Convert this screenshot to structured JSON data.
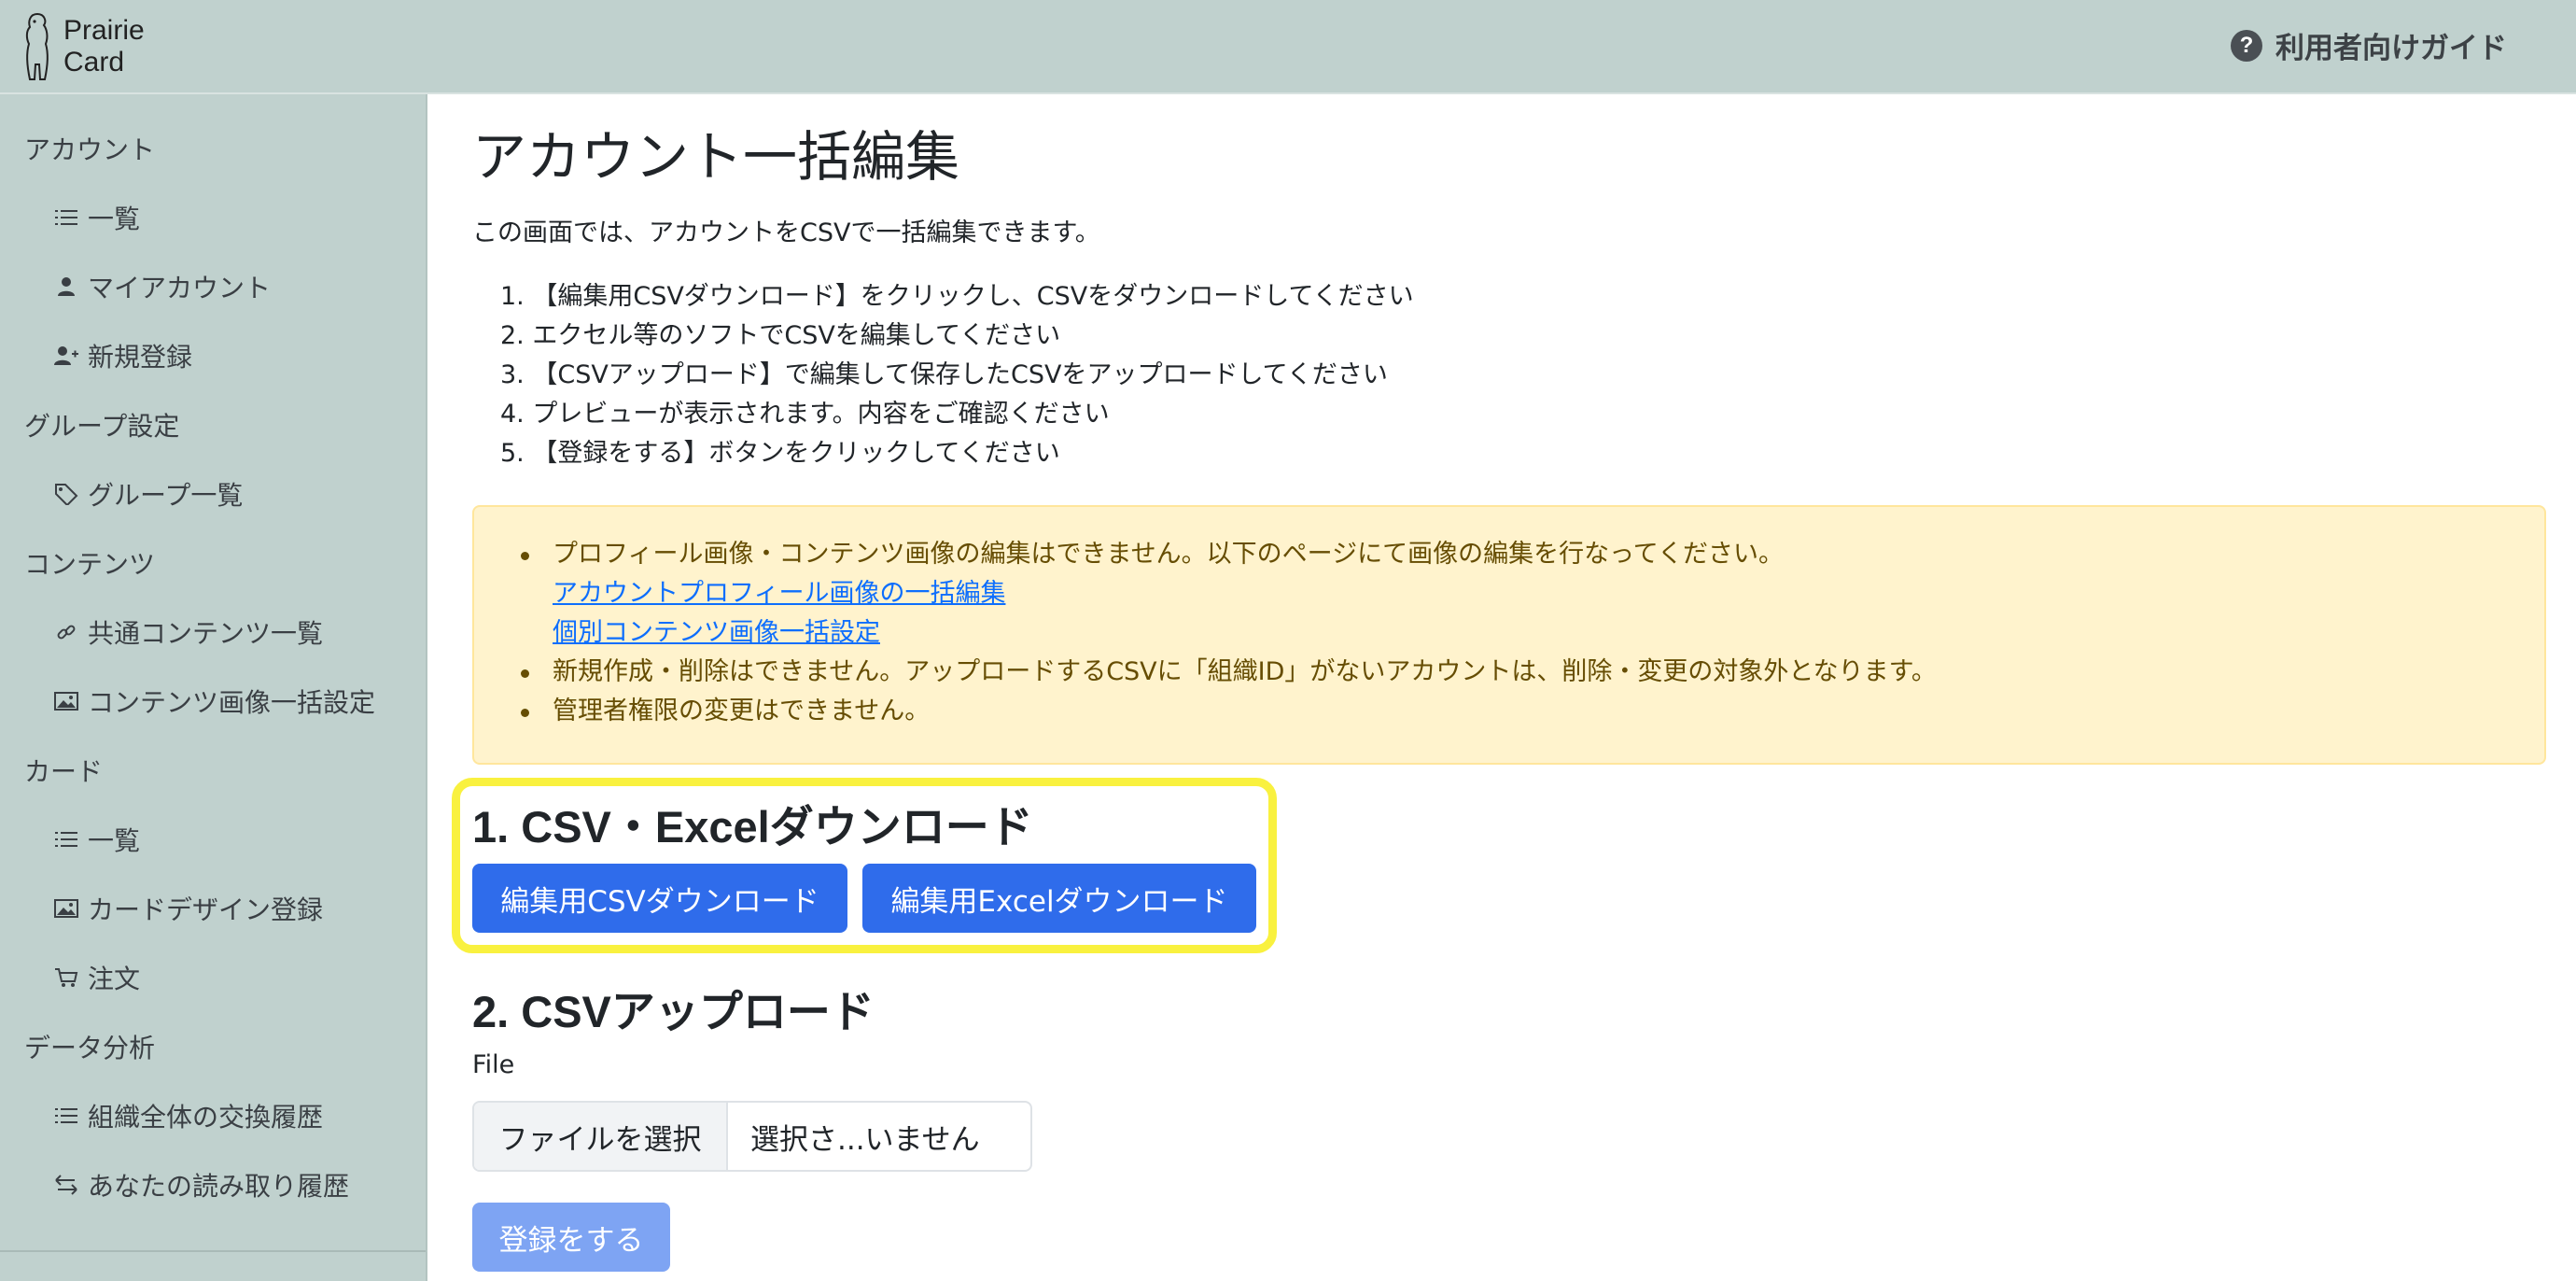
{
  "header": {
    "logo_line1": "Prairie",
    "logo_line2": "Card",
    "guide_label": "利用者向けガイド",
    "guide_icon": "question-circle-icon"
  },
  "sidebar": {
    "sections": [
      {
        "label": "アカウント",
        "items": [
          {
            "label": "一覧",
            "icon": "list-icon"
          },
          {
            "label": "マイアカウント",
            "icon": "person-icon"
          },
          {
            "label": "新規登録",
            "icon": "person-add-icon"
          }
        ]
      },
      {
        "label": "グループ設定",
        "items": [
          {
            "label": "グループ一覧",
            "icon": "tags-icon"
          }
        ]
      },
      {
        "label": "コンテンツ",
        "items": [
          {
            "label": "共通コンテンツ一覧",
            "icon": "link-icon"
          },
          {
            "label": "コンテンツ画像一括設定",
            "icon": "image-icon"
          }
        ]
      },
      {
        "label": "カード",
        "items": [
          {
            "label": "一覧",
            "icon": "list-icon"
          },
          {
            "label": "カードデザイン登録",
            "icon": "image-icon"
          },
          {
            "label": "注文",
            "icon": "cart-icon"
          }
        ]
      },
      {
        "label": "データ分析",
        "items": [
          {
            "label": "組織全体の交換履歴",
            "icon": "list-icon"
          },
          {
            "label": "あなたの読み取り履歴",
            "icon": "arrow-left-right-icon"
          }
        ]
      }
    ]
  },
  "main": {
    "title": "アカウント一括編集",
    "intro": "この画面では、アカウントをCSVで一括編集できます。",
    "steps": [
      "1. 【編集用CSVダウンロード】をクリックし、CSVをダウンロードしてください",
      "2. エクセル等のソフトでCSVを編集してください",
      "3. 【CSVアップロード】で編集して保存したCSVをアップロードしてください",
      "4. プレビューが表示されます。内容をご確認ください",
      "5. 【登録をする】ボタンをクリックしてください"
    ],
    "notice": {
      "item1": "プロフィール画像・コンテンツ画像の編集はできません。以下のページにて画像の編集を行なってください。",
      "link1": "アカウントプロフィール画像の一括編集",
      "link2": "個別コンテンツ画像一括設定",
      "item2": "新規作成・削除はできません。アップロードするCSVに「組織ID」がないアカウントは、削除・変更の対象外となります。",
      "item3": "管理者権限の変更はできません。"
    },
    "download": {
      "title": "1. CSV・Excelダウンロード",
      "csv_button": "編集用CSVダウンロード",
      "excel_button": "編集用Excelダウンロード"
    },
    "upload": {
      "title": "2. CSVアップロード",
      "file_label": "File",
      "choose_button": "ファイルを選択",
      "file_status": "選択さ...いません",
      "submit_button": "登録をする"
    }
  },
  "colors": {
    "header_bg": "#c0d1ce",
    "primary": "#2f6ceb",
    "primary_disabled": "#7ea4f3",
    "warning_bg": "#fff3cd",
    "highlight": "#f9f13f"
  }
}
